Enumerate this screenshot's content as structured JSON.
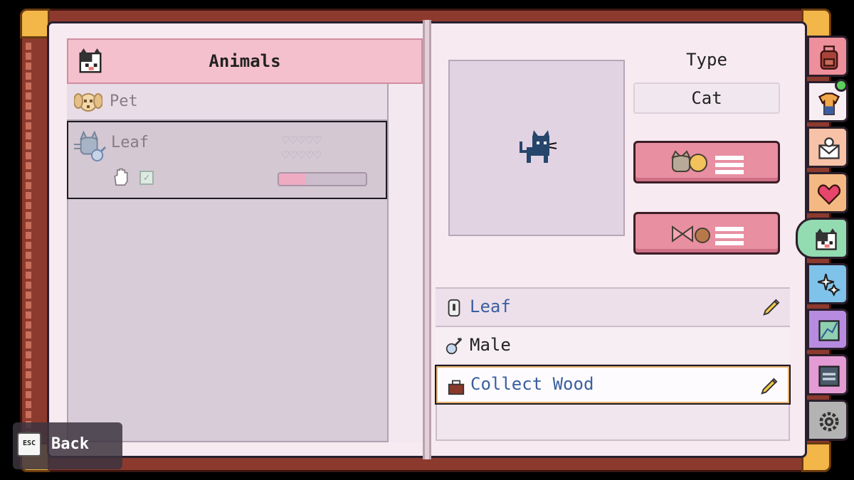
{
  "list": {
    "header": "Animals",
    "items": [
      {
        "label": "Pet"
      },
      {
        "label": "Leaf",
        "hearts": "♡♡♡♡♡\n♡♡♡♡♡",
        "friendship_fraction": 0.3
      }
    ]
  },
  "detail": {
    "type_label": "Type",
    "type_value": "Cat",
    "name": "Leaf",
    "gender": "Male",
    "job": "Collect Wood"
  },
  "tabs": [
    {
      "icon": "backpack-icon",
      "color": "#ee8f9c"
    },
    {
      "icon": "shirt-icon",
      "color": "#f7eef4"
    },
    {
      "icon": "mail-icon",
      "color": "#f7c2a7"
    },
    {
      "icon": "heart-icon",
      "color": "#f4b982"
    },
    {
      "icon": "animals-icon",
      "color": "#93dbb0"
    },
    {
      "icon": "sparkle-icon",
      "color": "#7fc2ea"
    },
    {
      "icon": "map-icon",
      "color": "#b78ce0"
    },
    {
      "icon": "journal-icon",
      "color": "#e49bd3"
    },
    {
      "icon": "settings-icon",
      "color": "#b3b3b3"
    }
  ],
  "footer": {
    "key": "ESC",
    "back_label": "Back"
  },
  "colors": {
    "accent_pink": "#e88fa2",
    "name_blue": "#3a5fa0"
  }
}
